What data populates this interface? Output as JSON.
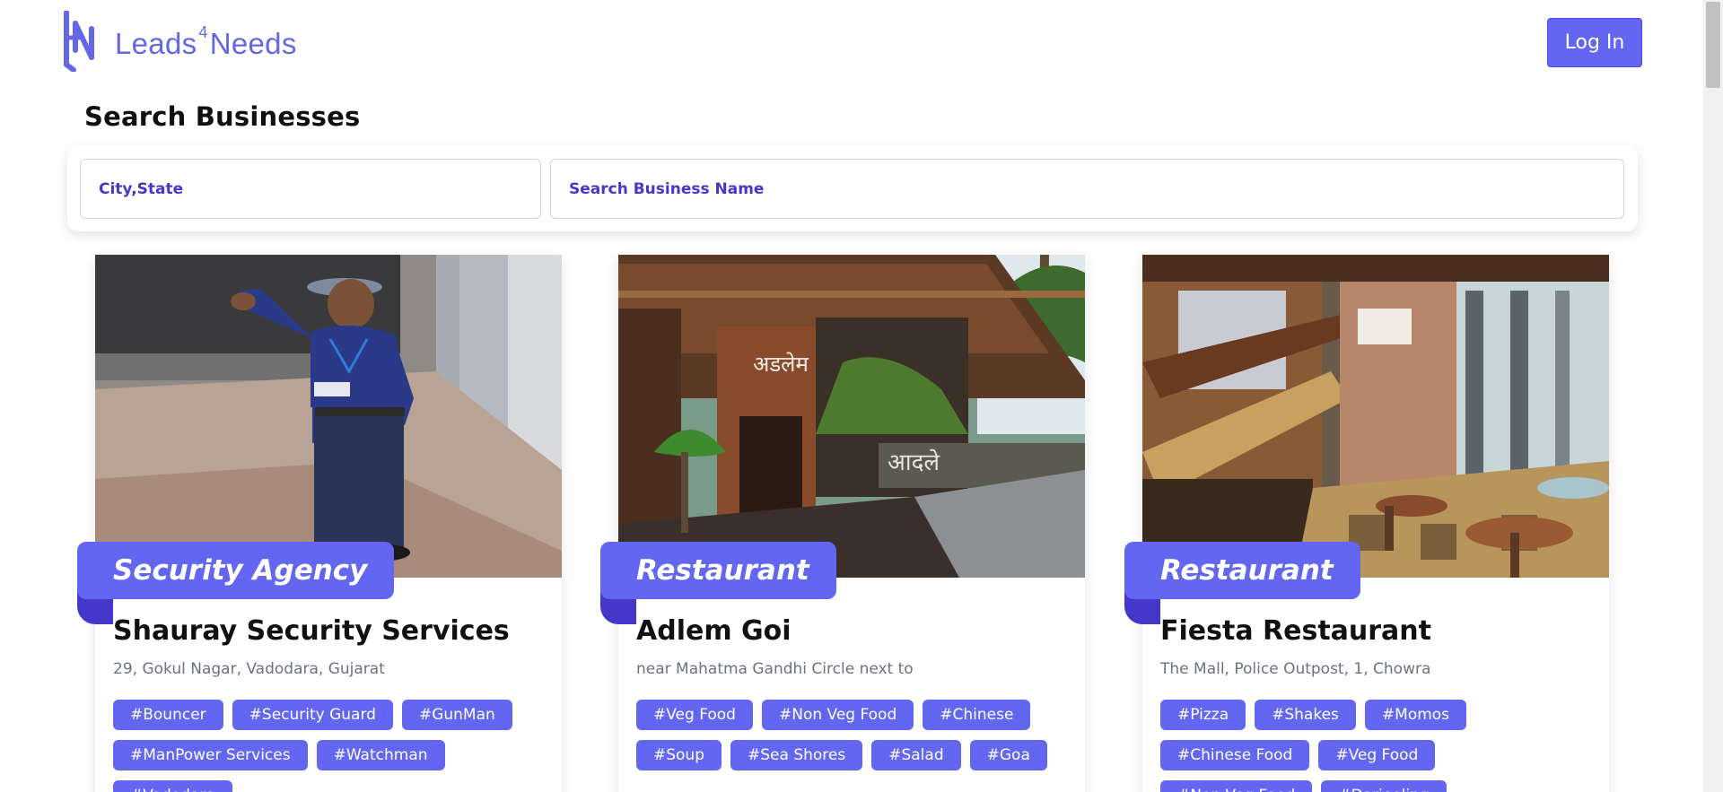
{
  "header": {
    "brand_main": "Leads",
    "brand_sup": "4",
    "brand_end": "Needs",
    "login_label": "Log In"
  },
  "search": {
    "title": "Search Businesses",
    "city_placeholder": "City,State",
    "name_placeholder": "Search Business Name"
  },
  "colors": {
    "accent": "#6366f1",
    "accent_dark": "#4338ca",
    "brand": "#6466e8"
  },
  "cards": [
    {
      "category": "Security Agency",
      "name": "Shauray Security Services",
      "address": "29, Gokul Nagar, Vadodara, Gujarat",
      "tags": [
        "#Bouncer",
        "#Security Guard",
        "#GunMan",
        "#ManPower Services",
        "#Watchman",
        "#Vadodara"
      ]
    },
    {
      "category": "Restaurant",
      "name": "Adlem Goi",
      "address": "near Mahatma Gandhi Circle next to",
      "tags": [
        "#Veg Food",
        "#Non Veg Food",
        "#Chinese",
        "#Soup",
        "#Sea Shores",
        "#Salad",
        "#Goa"
      ]
    },
    {
      "category": "Restaurant",
      "name": "Fiesta Restaurant",
      "address": "The Mall, Police Outpost, 1, Chowra",
      "tags": [
        "#Pizza",
        "#Shakes",
        "#Momos",
        "#Chinese Food",
        "#Veg Food",
        "#Non Veg Food",
        "#Darjeeling"
      ]
    }
  ]
}
